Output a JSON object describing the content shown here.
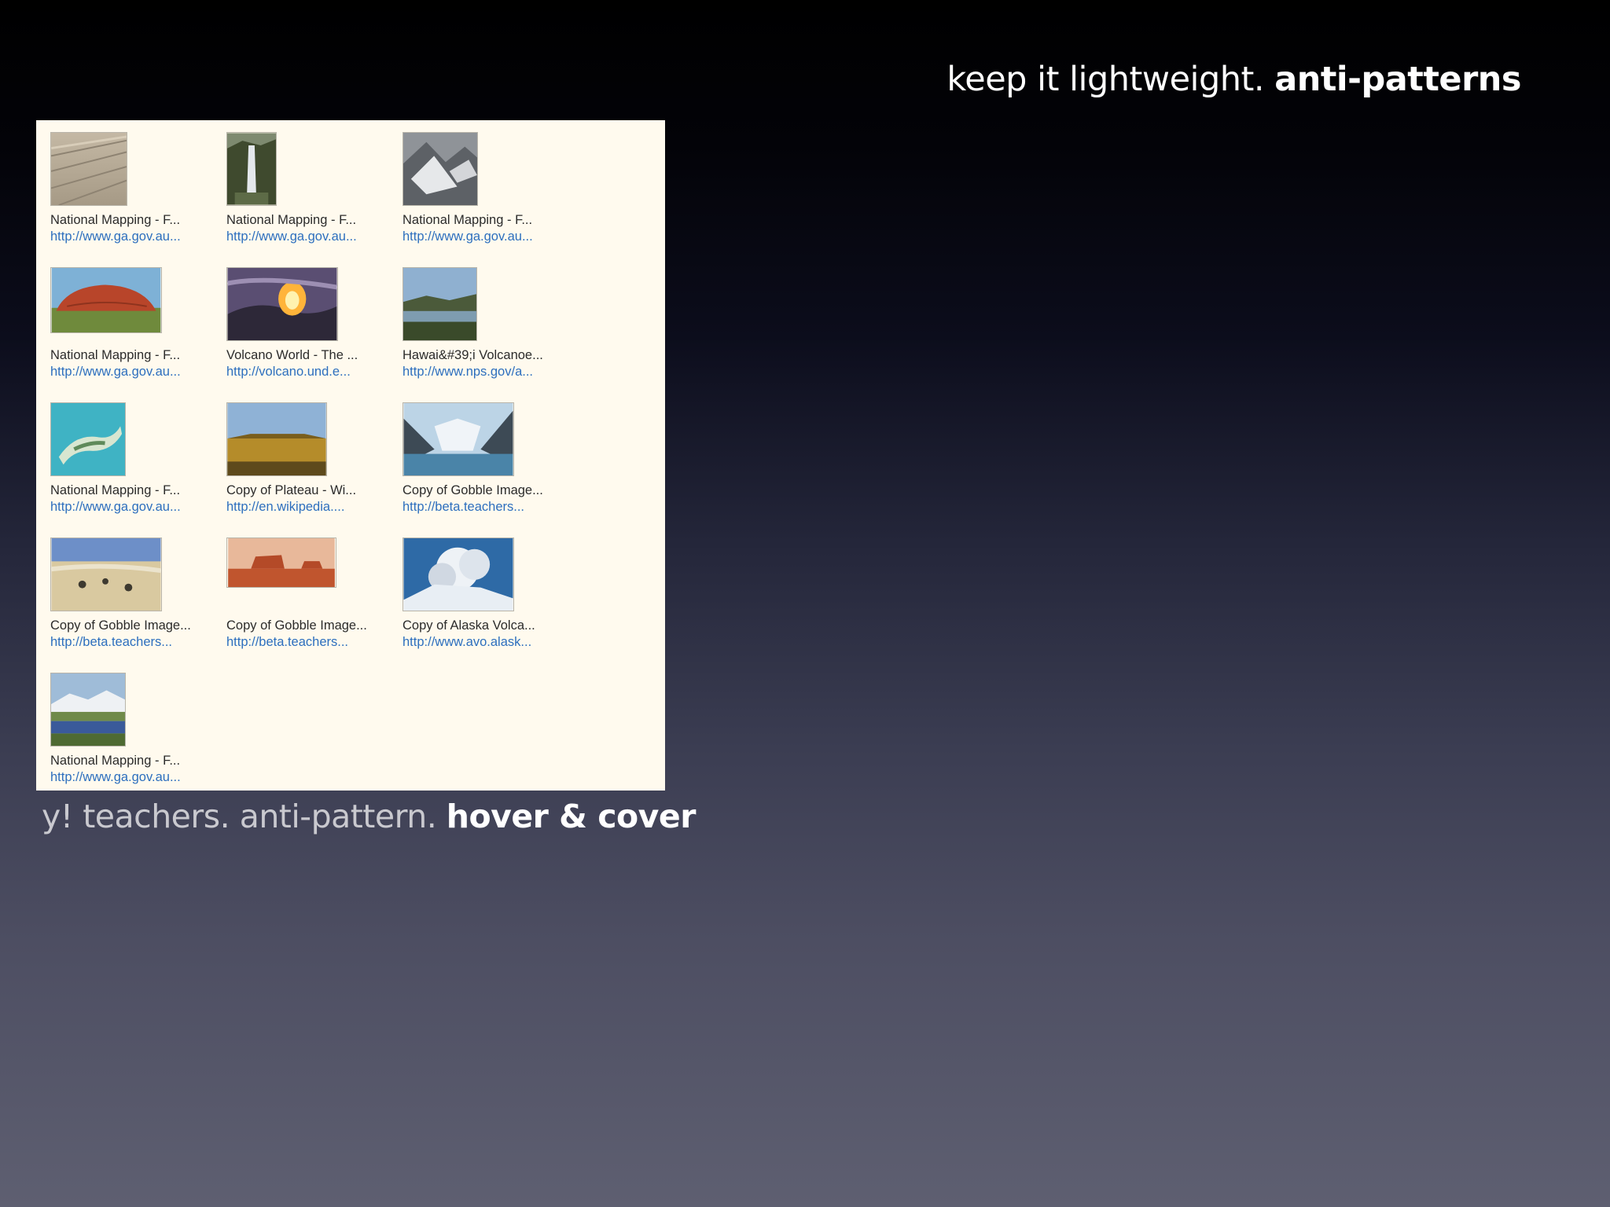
{
  "slide_title": {
    "prefix": "keep it lightweight.",
    "emphasis": "anti-patterns"
  },
  "results": [
    {
      "title": "National Mapping - F...",
      "url": "http://www.ga.gov.au...",
      "thumb": "desert-plain"
    },
    {
      "title": "National Mapping - F...",
      "url": "http://www.ga.gov.au...",
      "thumb": "waterfall"
    },
    {
      "title": "National Mapping - F...",
      "url": "http://www.ga.gov.au...",
      "thumb": "snowy-mountains"
    },
    {
      "title": "National Mapping - F...",
      "url": "http://www.ga.gov.au...",
      "thumb": "uluru"
    },
    {
      "title": "Volcano World - The ...",
      "url": "http://volcano.und.e...",
      "thumb": "lava-flow"
    },
    {
      "title": "Hawai&#39;i Volcanoe...",
      "url": "http://www.nps.gov/a...",
      "thumb": "hawaii-landscape"
    },
    {
      "title": "National Mapping - F...",
      "url": "http://www.ga.gov.au...",
      "thumb": "island-aerial"
    },
    {
      "title": "Copy of Plateau - Wi...",
      "url": "http://en.wikipedia....",
      "thumb": "plateau"
    },
    {
      "title": "Copy of Gobble Image...",
      "url": "http://beta.teachers...",
      "thumb": "glacier"
    },
    {
      "title": "Copy of Gobble Image...",
      "url": "http://beta.teachers...",
      "thumb": "desert-beach"
    },
    {
      "title": "Copy of Gobble Image...",
      "url": "http://beta.teachers...",
      "thumb": "mesa"
    },
    {
      "title": "Copy of Alaska Volca...",
      "url": "http://www.avo.alask...",
      "thumb": "volcano-plume"
    },
    {
      "title": "National Mapping - F...",
      "url": "http://www.ga.gov.au...",
      "thumb": "lake-mountains"
    }
  ],
  "caption": {
    "prefix": "y! teachers. anti-pattern.",
    "emphasis": "hover & cover"
  }
}
